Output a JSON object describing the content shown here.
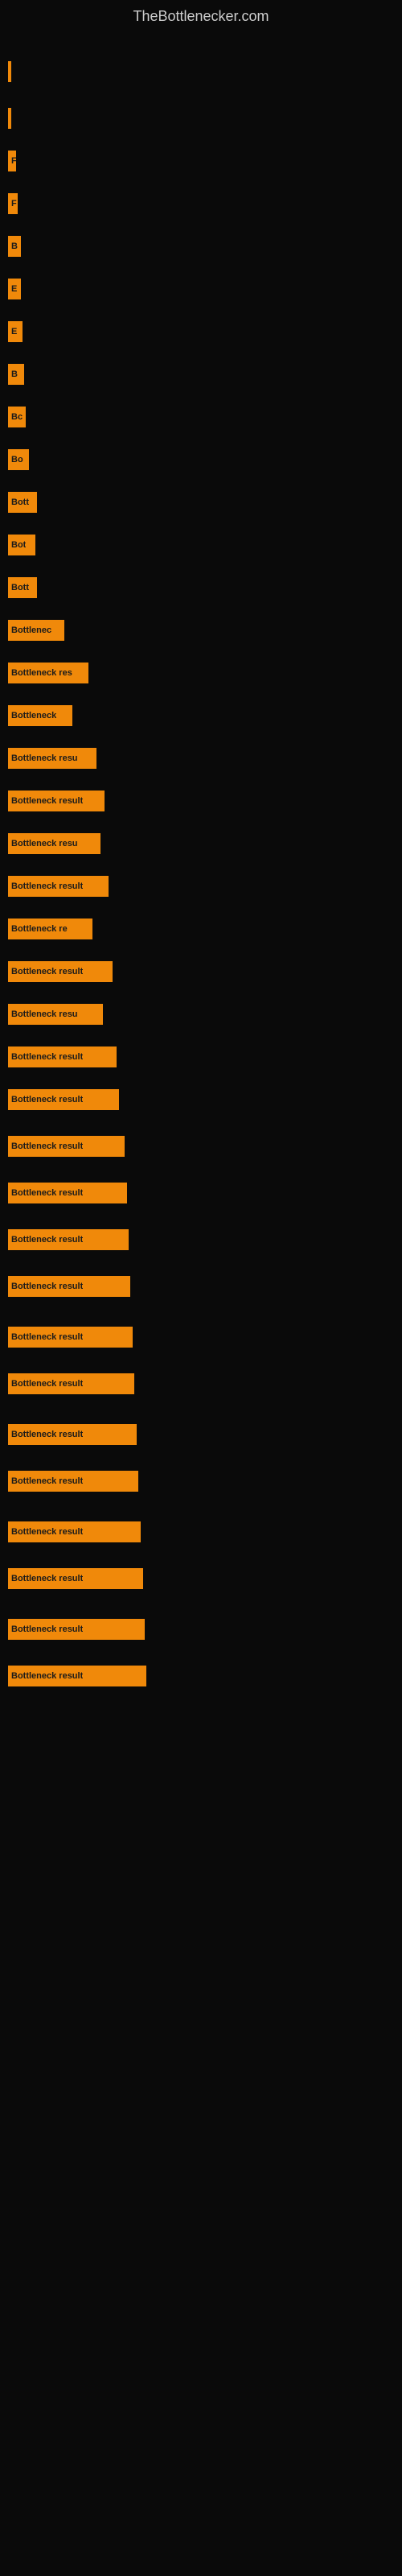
{
  "site": {
    "title": "TheBottlenecker.com"
  },
  "bars": [
    {
      "label": "",
      "width": 4,
      "top_gap": 30
    },
    {
      "label": "",
      "width": 4,
      "top_gap": 30
    },
    {
      "label": "F",
      "width": 10,
      "top_gap": 25
    },
    {
      "label": "F",
      "width": 12,
      "top_gap": 25
    },
    {
      "label": "B",
      "width": 16,
      "top_gap": 25
    },
    {
      "label": "E",
      "width": 16,
      "top_gap": 25
    },
    {
      "label": "E",
      "width": 18,
      "top_gap": 25
    },
    {
      "label": "B",
      "width": 20,
      "top_gap": 25
    },
    {
      "label": "Bc",
      "width": 22,
      "top_gap": 25
    },
    {
      "label": "Bo",
      "width": 26,
      "top_gap": 25
    },
    {
      "label": "Bott",
      "width": 36,
      "top_gap": 25
    },
    {
      "label": "Bot",
      "width": 34,
      "top_gap": 25
    },
    {
      "label": "Bott",
      "width": 36,
      "top_gap": 25
    },
    {
      "label": "Bottlenec",
      "width": 70,
      "top_gap": 25
    },
    {
      "label": "Bottleneck res",
      "width": 100,
      "top_gap": 25
    },
    {
      "label": "Bottleneck",
      "width": 80,
      "top_gap": 25
    },
    {
      "label": "Bottleneck resu",
      "width": 110,
      "top_gap": 25
    },
    {
      "label": "Bottleneck result",
      "width": 120,
      "top_gap": 25
    },
    {
      "label": "Bottleneck resu",
      "width": 115,
      "top_gap": 25
    },
    {
      "label": "Bottleneck result",
      "width": 125,
      "top_gap": 25
    },
    {
      "label": "Bottleneck re",
      "width": 105,
      "top_gap": 25
    },
    {
      "label": "Bottleneck result",
      "width": 130,
      "top_gap": 25
    },
    {
      "label": "Bottleneck resu",
      "width": 118,
      "top_gap": 25
    },
    {
      "label": "Bottleneck result",
      "width": 135,
      "top_gap": 25
    },
    {
      "label": "Bottleneck result",
      "width": 138,
      "top_gap": 25
    },
    {
      "label": "Bottleneck result",
      "width": 145,
      "top_gap": 30
    },
    {
      "label": "Bottleneck result",
      "width": 148,
      "top_gap": 30
    },
    {
      "label": "Bottleneck result",
      "width": 150,
      "top_gap": 30
    },
    {
      "label": "Bottleneck result",
      "width": 152,
      "top_gap": 30
    },
    {
      "label": "Bottleneck result",
      "width": 155,
      "top_gap": 35
    },
    {
      "label": "Bottleneck result",
      "width": 157,
      "top_gap": 30
    },
    {
      "label": "Bottleneck result",
      "width": 160,
      "top_gap": 35
    },
    {
      "label": "Bottleneck result",
      "width": 162,
      "top_gap": 30
    },
    {
      "label": "Bottleneck result",
      "width": 165,
      "top_gap": 35
    },
    {
      "label": "Bottleneck result",
      "width": 168,
      "top_gap": 30
    },
    {
      "label": "Bottleneck result",
      "width": 170,
      "top_gap": 35
    },
    {
      "label": "Bottleneck result",
      "width": 172,
      "top_gap": 30
    }
  ]
}
